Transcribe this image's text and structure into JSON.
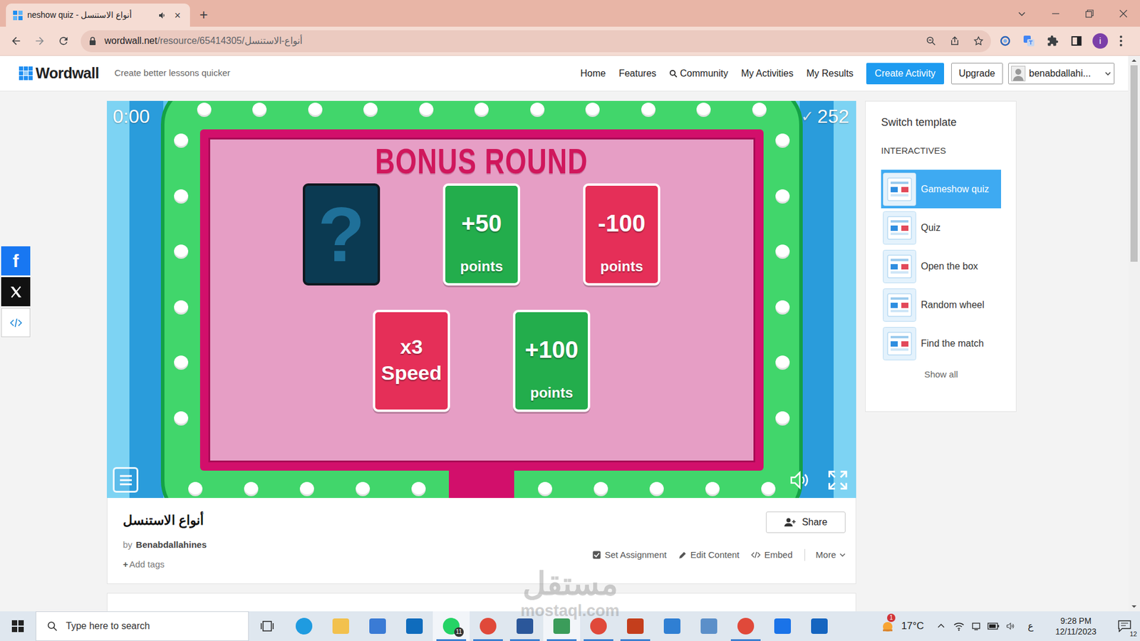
{
  "browser": {
    "tab_title": "neshow quiz - أنواع الاستنسل",
    "tab_close": "×",
    "new_tab": "+",
    "url_host": "wordwall.net",
    "url_path": "/resource/65414305/أنواع-الاستنسل",
    "profile": "i"
  },
  "header": {
    "logo": "Wordwall",
    "tagline": "Create better lessons quicker",
    "nav": [
      {
        "label": "Home",
        "kind": "link"
      },
      {
        "label": "Features",
        "kind": "link"
      },
      {
        "label": "Community",
        "kind": "search"
      },
      {
        "label": "My Activities",
        "kind": "link"
      },
      {
        "label": "My Results",
        "kind": "link"
      }
    ],
    "create_button": "Create Activity",
    "upgrade_button": "Upgrade",
    "user": "benabdallahi..."
  },
  "social": {
    "facebook": "f"
  },
  "game": {
    "timer": "0:00",
    "score_icon": "✓",
    "score": "252",
    "title": "BONUS ROUND",
    "rows": [
      [
        {
          "kind": "mystery",
          "value": "?",
          "color": "#0b3a52"
        },
        {
          "kind": "points",
          "value": "+50",
          "unit": "points",
          "color": "#23ad4c"
        },
        {
          "kind": "points",
          "value": "-100",
          "unit": "points",
          "color": "#e52f58"
        }
      ],
      [
        {
          "kind": "speed",
          "value": "x3",
          "unit": "Speed",
          "color": "#e52f58"
        },
        {
          "kind": "points",
          "value": "+100",
          "unit": "points",
          "color": "#23ad4c"
        }
      ]
    ]
  },
  "activity": {
    "title": "أنواع الاستنسل",
    "by": "by",
    "author": "Benabdallahines",
    "add_icon": "+",
    "add_tags": "Add tags",
    "share": "Share",
    "actions": [
      {
        "label": "Set Assignment",
        "kind": "checkbox"
      },
      {
        "label": "Edit Content",
        "kind": "edit"
      },
      {
        "label": "Embed",
        "kind": "embed"
      },
      {
        "label": "More",
        "kind": "menu"
      }
    ]
  },
  "sidebar": {
    "title": "Switch template",
    "section": "INTERACTIVES",
    "items": [
      {
        "label": "Gameshow quiz",
        "selected": true
      },
      {
        "label": "Quiz",
        "selected": false
      },
      {
        "label": "Open the box",
        "selected": false
      },
      {
        "label": "Random wheel",
        "selected": false
      },
      {
        "label": "Find the match",
        "selected": false
      }
    ],
    "show_all": "Show all"
  },
  "watermark": {
    "arabic": "مستقل",
    "latin": "mostaql.com"
  },
  "taskbar": {
    "search_placeholder": "Type here to search",
    "apps": [
      {
        "kind": "circle",
        "color": "#1f9be0",
        "open": false,
        "selected": false
      },
      {
        "kind": "square",
        "color": "#f2c14e",
        "open": false,
        "selected": false
      },
      {
        "kind": "square",
        "color": "#3a7bd5",
        "open": false,
        "selected": false
      },
      {
        "kind": "square",
        "color": "#0f6cbd",
        "open": false,
        "selected": false
      },
      {
        "kind": "circle",
        "color": "#25d366",
        "open": true,
        "selected": true,
        "badge": "11"
      },
      {
        "kind": "circle",
        "color": "#e0493a",
        "open": true,
        "selected": false
      },
      {
        "kind": "square",
        "color": "#2b579a",
        "open": true,
        "selected": false
      },
      {
        "kind": "square",
        "color": "#3b9c5a",
        "open": true,
        "selected": true
      },
      {
        "kind": "circle",
        "color": "#e0493a",
        "open": true,
        "selected": false
      },
      {
        "kind": "square",
        "color": "#c43e1c",
        "open": true,
        "selected": false
      },
      {
        "kind": "square",
        "color": "#2f7fd3",
        "open": false,
        "selected": false
      },
      {
        "kind": "square",
        "color": "#5b8fc9",
        "open": false,
        "selected": false
      },
      {
        "kind": "circle",
        "color": "#e0493a",
        "open": true,
        "selected": false
      },
      {
        "kind": "square",
        "color": "#1a73e8",
        "open": false,
        "selected": false
      },
      {
        "kind": "square",
        "color": "#1565c0",
        "open": false,
        "selected": false
      }
    ],
    "weather_badge": "1",
    "weather": "17°C",
    "language": "ع",
    "time": "9:28 PM",
    "date": "12/11/2023",
    "notifications": "12"
  }
}
